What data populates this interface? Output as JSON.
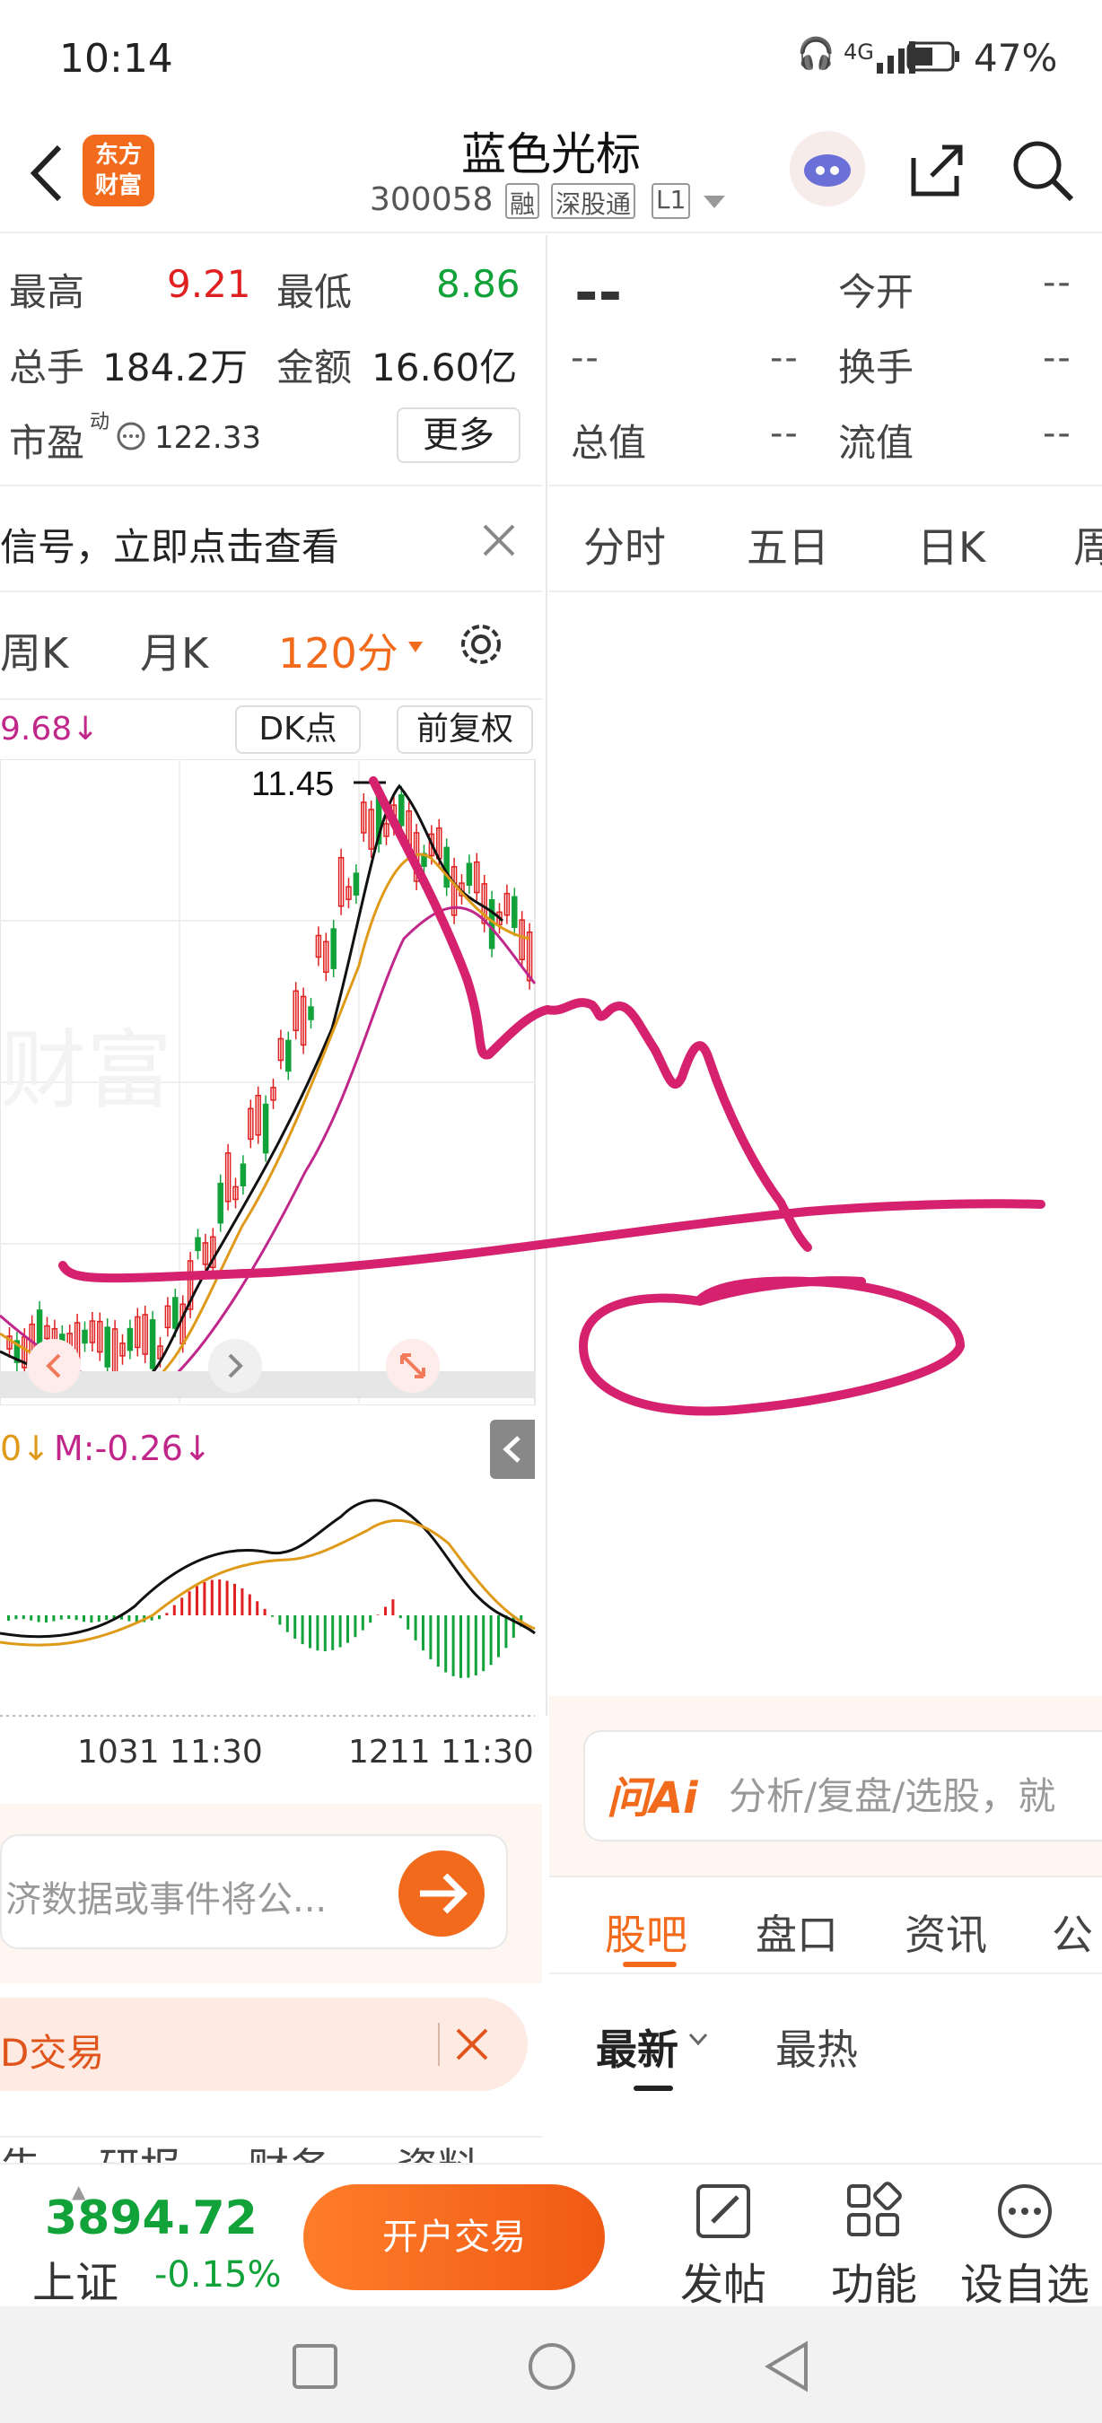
{
  "status": {
    "time": "10:14",
    "network": "4G",
    "battery": "47%"
  },
  "header": {
    "app_logo_line1": "东方",
    "app_logo_line2": "财富",
    "stock_name": "蓝色光标",
    "stock_code": "300058",
    "badges": [
      "融",
      "深股通",
      "L1"
    ]
  },
  "quote_left": {
    "high_label": "最高",
    "high": "9.21",
    "low_label": "最低",
    "low": "8.86",
    "volume_label": "总手",
    "volume": "184.2万",
    "amount_label": "金额",
    "amount": "16.60亿",
    "pe_label": "市盈",
    "pe_sup": "动",
    "pe": "122.33",
    "more_button": "更多"
  },
  "quote_right": {
    "price": "--",
    "open_label": "今开",
    "open": "--",
    "change1": "--",
    "change2": "--",
    "turnover_label": "换手",
    "turnover": "--",
    "total_value_label": "总值",
    "total_value": "--",
    "float_value_label": "流值",
    "float_value": "--"
  },
  "banner_left": {
    "text": "信号，立即点击查看"
  },
  "tabs_left": [
    "周K",
    "月K",
    "120分"
  ],
  "tabs_right": [
    "分时",
    "五日",
    "日K",
    "周"
  ],
  "chart_toolbar": {
    "ma_value": "9.68↓",
    "dk_button": "DK点",
    "adjust_button": "前复权",
    "peak_label": "11.45"
  },
  "macd": {
    "m_label": "M:-0.26↓",
    "left_arrow": "0↓"
  },
  "time_axis": [
    "1031 11:30",
    "1211 11:30"
  ],
  "ask_box": {
    "placeholder": "济数据或事件将公...",
    "ai_logo": "问Ai",
    "ai_placeholder": "分析/复盘/选股，就"
  },
  "trade_banner": {
    "text": "D交易"
  },
  "info_tabs_left": [
    "告",
    "研报",
    "财务",
    "资料"
  ],
  "info_tabs_right": [
    "股吧",
    "盘口",
    "资讯",
    "公"
  ],
  "sort_tabs": [
    "最新",
    "最热"
  ],
  "bottom": {
    "index_value": "3894.72",
    "index_name": "上证",
    "index_change": "-0.15%",
    "open_account_button": "开户交易",
    "nav": [
      "发帖",
      "功能",
      "设自选"
    ]
  },
  "colors": {
    "accent": "#f26a1b",
    "up": "#e02020",
    "down": "#12a23a",
    "annotation": "#d6226e"
  },
  "chart_data": {
    "type": "candlestick",
    "title": "",
    "xlabel": "",
    "ylabel": "",
    "x_ticks": [
      "1031 11:30",
      "1211 11:30"
    ],
    "annotations": [
      "11.45"
    ],
    "series": [
      {
        "name": "M",
        "values": [
          -0.26
        ]
      }
    ]
  }
}
